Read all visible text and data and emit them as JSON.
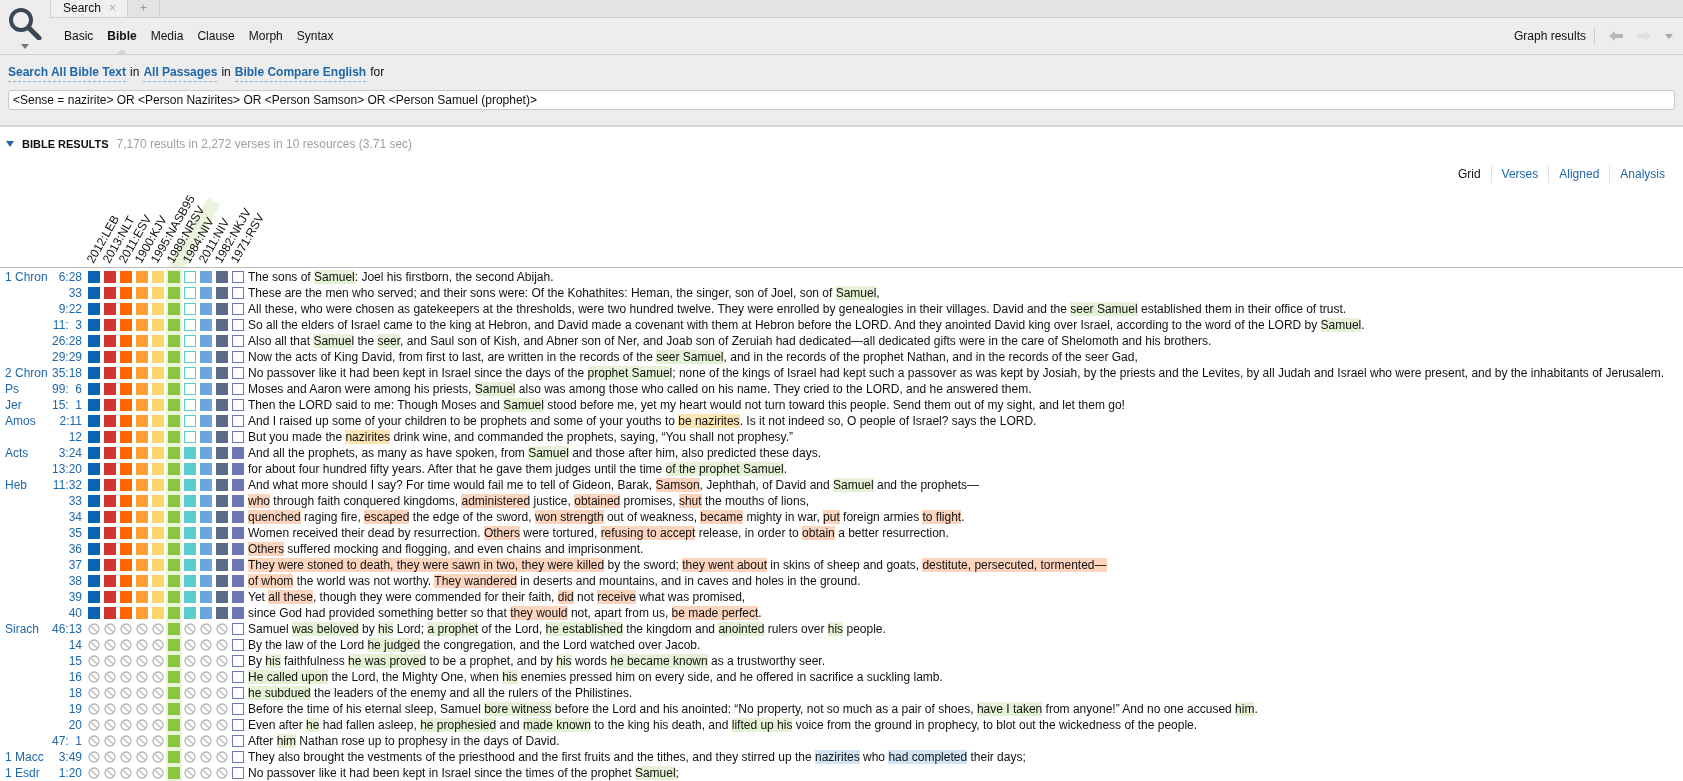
{
  "tabs": [
    {
      "label": "Search",
      "selected": true,
      "close": "×"
    },
    {
      "label": "+",
      "selected": false
    }
  ],
  "search_types": [
    {
      "label": "Basic",
      "selected": false
    },
    {
      "label": "Bible",
      "selected": true
    },
    {
      "label": "Media",
      "selected": false
    },
    {
      "label": "Clause",
      "selected": false
    },
    {
      "label": "Morph",
      "selected": false
    },
    {
      "label": "Syntax",
      "selected": false
    }
  ],
  "toolbar_right": {
    "graph": "Graph results"
  },
  "query_line": [
    {
      "text": "Search All Bible Text",
      "kind": "link"
    },
    {
      "text": "in",
      "kind": "plain"
    },
    {
      "text": "All Passages",
      "kind": "link"
    },
    {
      "text": "in",
      "kind": "plain"
    },
    {
      "text": "Bible Compare English",
      "kind": "link"
    },
    {
      "text": "for",
      "kind": "plain"
    }
  ],
  "query": {
    "value": "<Sense = nazirite> OR <Person Nazirites> OR <Person Samson> OR <Person Samuel (prophet)>"
  },
  "results": {
    "title": "BIBLE RESULTS",
    "expanded": true,
    "summary": "7,170 results in 2,272 verses in 10 resources (3.71 sec)"
  },
  "views": [
    {
      "label": "Grid",
      "selected": true
    },
    {
      "label": "Verses",
      "selected": false
    },
    {
      "label": "Aligned",
      "selected": false
    },
    {
      "label": "Analysis",
      "selected": false
    }
  ],
  "columns": [
    {
      "label": "2012:LEB",
      "color": "#0a64b4",
      "selected": false
    },
    {
      "label": "2013:NLT",
      "color": "#d0352f",
      "selected": false
    },
    {
      "label": "2011:ESV",
      "color": "#ff6600",
      "selected": false
    },
    {
      "label": "1900:KJV",
      "color": "#ff9e33",
      "selected": false
    },
    {
      "label": "1995:NASB95",
      "color": "#ffd56a",
      "selected": false
    },
    {
      "label": "1989:NRSV",
      "color": "#8cc63f",
      "selected": true
    },
    {
      "label": "1984:NIV",
      "color": "#5ccccc",
      "selected": false
    },
    {
      "label": "2011:NIV",
      "color": "#6aa5e0",
      "selected": false
    },
    {
      "label": "1982:NKJV",
      "color": "#5c6b86",
      "selected": false
    },
    {
      "label": "1971:RSV",
      "color": "#6e77b3",
      "selected": false
    }
  ],
  "rows": [
    {
      "book": "1 Chron",
      "ref": "6:28",
      "cells": [
        {
          "kind": "filled"
        },
        {
          "kind": "filled"
        },
        {
          "kind": "filled"
        },
        {
          "kind": "filled"
        },
        {
          "kind": "filled"
        },
        {
          "kind": "filled"
        },
        {
          "kind": "empty"
        },
        {
          "kind": "filled"
        },
        {
          "kind": "filled"
        },
        {
          "kind": "empty"
        }
      ],
      "segments": [
        {
          "text": "The sons of "
        },
        {
          "text": "Samuel",
          "color": "#e6f2d6"
        },
        {
          "text": ": Joel his firstborn, the second Abijah."
        }
      ]
    },
    {
      "ref": "33",
      "cells": [
        {
          "kind": "filled"
        },
        {
          "kind": "filled"
        },
        {
          "kind": "filled"
        },
        {
          "kind": "filled"
        },
        {
          "kind": "filled"
        },
        {
          "kind": "filled"
        },
        {
          "kind": "empty"
        },
        {
          "kind": "filled"
        },
        {
          "kind": "filled"
        },
        {
          "kind": "empty"
        }
      ],
      "segments": [
        {
          "text": "These are the men who served; and their sons were: Of the Kohathites: Heman, the singer, son of Joel, son of "
        },
        {
          "text": "Samuel",
          "color": "#e6f2d6"
        },
        {
          "text": ","
        }
      ]
    },
    {
      "ref": "9:22",
      "cells": [
        {
          "kind": "filled"
        },
        {
          "kind": "filled"
        },
        {
          "kind": "filled"
        },
        {
          "kind": "filled"
        },
        {
          "kind": "filled"
        },
        {
          "kind": "filled"
        },
        {
          "kind": "empty"
        },
        {
          "kind": "filled"
        },
        {
          "kind": "filled"
        },
        {
          "kind": "empty"
        }
      ],
      "segments": [
        {
          "text": "All these, who were chosen as gatekeepers at the thresholds, were two hundred twelve. They were enrolled by genealogies in their villages. David and the "
        },
        {
          "text": "seer Samuel",
          "color": "#e6f2d6"
        },
        {
          "text": " established them in their office of trust."
        }
      ]
    },
    {
      "ref": "11:  3",
      "cells": [
        {
          "kind": "filled"
        },
        {
          "kind": "filled"
        },
        {
          "kind": "filled"
        },
        {
          "kind": "filled"
        },
        {
          "kind": "filled"
        },
        {
          "kind": "filled"
        },
        {
          "kind": "empty"
        },
        {
          "kind": "filled"
        },
        {
          "kind": "filled"
        },
        {
          "kind": "empty"
        }
      ],
      "segments": [
        {
          "text": "So all the elders of Israel came to the king at Hebron, and David made a covenant with them at Hebron before the LORD. And they anointed David king over Israel, according to the word of the LORD by "
        },
        {
          "text": "Samuel",
          "color": "#e6f2d6"
        },
        {
          "text": "."
        }
      ]
    },
    {
      "ref": "26:28",
      "cells": [
        {
          "kind": "filled"
        },
        {
          "kind": "filled"
        },
        {
          "kind": "filled"
        },
        {
          "kind": "filled"
        },
        {
          "kind": "filled"
        },
        {
          "kind": "filled"
        },
        {
          "kind": "empty"
        },
        {
          "kind": "filled"
        },
        {
          "kind": "filled"
        },
        {
          "kind": "empty"
        }
      ],
      "segments": [
        {
          "text": "Also all that "
        },
        {
          "text": "Samuel",
          "color": "#e6f2d6"
        },
        {
          "text": " the "
        },
        {
          "text": "seer",
          "color": "#e6f2d6"
        },
        {
          "text": ", and Saul son of Kish, and Abner son of Ner, and Joab son of Zeruiah had dedicated—all dedicated gifts were in the care of Shelomoth and his brothers."
        }
      ]
    },
    {
      "ref": "29:29",
      "cells": [
        {
          "kind": "filled"
        },
        {
          "kind": "filled"
        },
        {
          "kind": "filled"
        },
        {
          "kind": "filled"
        },
        {
          "kind": "filled"
        },
        {
          "kind": "filled"
        },
        {
          "kind": "empty"
        },
        {
          "kind": "filled"
        },
        {
          "kind": "filled"
        },
        {
          "kind": "empty"
        }
      ],
      "segments": [
        {
          "text": "Now the acts of King David, from first to last, are written in the records of the "
        },
        {
          "text": "seer Samuel",
          "color": "#e6f2d6"
        },
        {
          "text": ", and in the records of the prophet Nathan, and in the records of the seer Gad,"
        }
      ]
    },
    {
      "book": "2 Chron",
      "ref": "35:18",
      "cells": [
        {
          "kind": "filled"
        },
        {
          "kind": "filled"
        },
        {
          "kind": "filled"
        },
        {
          "kind": "filled"
        },
        {
          "kind": "filled"
        },
        {
          "kind": "filled"
        },
        {
          "kind": "empty"
        },
        {
          "kind": "filled"
        },
        {
          "kind": "filled"
        },
        {
          "kind": "empty"
        }
      ],
      "segments": [
        {
          "text": "No passover like it had been kept in Israel since the days of the "
        },
        {
          "text": "prophet Samuel",
          "color": "#e6f2d6"
        },
        {
          "text": "; none of the kings of Israel had kept such a passover as was kept by Josiah, by the priests and the Levites, by all Judah and Israel who were present, and by the inhabitants of Jerusalem."
        }
      ]
    },
    {
      "book": "Ps",
      "ref": "99:  6",
      "cells": [
        {
          "kind": "filled"
        },
        {
          "kind": "filled"
        },
        {
          "kind": "filled"
        },
        {
          "kind": "filled"
        },
        {
          "kind": "filled"
        },
        {
          "kind": "filled"
        },
        {
          "kind": "empty"
        },
        {
          "kind": "filled"
        },
        {
          "kind": "filled"
        },
        {
          "kind": "empty"
        }
      ],
      "segments": [
        {
          "text": "Moses and Aaron were among his priests, "
        },
        {
          "text": "Samuel",
          "color": "#e6f2d6"
        },
        {
          "text": " also was among those who called on his name. They cried to the LORD, and he answered them."
        }
      ]
    },
    {
      "book": "Jer",
      "ref": "15:  1",
      "cells": [
        {
          "kind": "filled"
        },
        {
          "kind": "filled"
        },
        {
          "kind": "filled"
        },
        {
          "kind": "filled"
        },
        {
          "kind": "filled"
        },
        {
          "kind": "filled"
        },
        {
          "kind": "empty"
        },
        {
          "kind": "filled"
        },
        {
          "kind": "filled"
        },
        {
          "kind": "empty"
        }
      ],
      "segments": [
        {
          "text": "Then the LORD said to me: Though Moses and "
        },
        {
          "text": "Samuel",
          "color": "#e6f2d6"
        },
        {
          "text": " stood before me, yet my heart would not turn toward this people. Send them out of my sight, and let them go!"
        }
      ]
    },
    {
      "book": "Amos",
      "ref": "2:11",
      "cells": [
        {
          "kind": "filled"
        },
        {
          "kind": "filled"
        },
        {
          "kind": "filled"
        },
        {
          "kind": "filled"
        },
        {
          "kind": "filled"
        },
        {
          "kind": "filled"
        },
        {
          "kind": "empty"
        },
        {
          "kind": "filled"
        },
        {
          "kind": "filled"
        },
        {
          "kind": "empty"
        }
      ],
      "segments": [
        {
          "text": "And I raised up some of your children to be prophets and some of your youths to "
        },
        {
          "text": "be nazirites",
          "color": "#fde6b3"
        },
        {
          "text": ". Is it not indeed so, O people of Israel? says the LORD."
        }
      ]
    },
    {
      "ref": "12",
      "cells": [
        {
          "kind": "filled"
        },
        {
          "kind": "filled"
        },
        {
          "kind": "filled"
        },
        {
          "kind": "filled"
        },
        {
          "kind": "filled"
        },
        {
          "kind": "filled"
        },
        {
          "kind": "empty"
        },
        {
          "kind": "filled"
        },
        {
          "kind": "filled"
        },
        {
          "kind": "empty"
        }
      ],
      "segments": [
        {
          "text": "But you made the "
        },
        {
          "text": "nazirites",
          "color": "#fde6b3"
        },
        {
          "text": " drink wine, and commanded the prophets, saying, “You shall not prophesy.”"
        }
      ]
    },
    {
      "book": "Acts",
      "ref": "3:24",
      "cells": [
        {
          "kind": "filled"
        },
        {
          "kind": "filled"
        },
        {
          "kind": "filled"
        },
        {
          "kind": "filled"
        },
        {
          "kind": "filled"
        },
        {
          "kind": "filled"
        },
        {
          "kind": "filled"
        },
        {
          "kind": "filled"
        },
        {
          "kind": "filled"
        },
        {
          "kind": "filled"
        }
      ],
      "segments": [
        {
          "text": "And all the prophets, as many as have spoken, from "
        },
        {
          "text": "Samuel",
          "color": "#e6f2d6"
        },
        {
          "text": " and those after him, also predicted these days."
        }
      ]
    },
    {
      "ref": "13:20",
      "cells": [
        {
          "kind": "filled"
        },
        {
          "kind": "filled"
        },
        {
          "kind": "filled"
        },
        {
          "kind": "filled"
        },
        {
          "kind": "filled"
        },
        {
          "kind": "filled"
        },
        {
          "kind": "filled"
        },
        {
          "kind": "filled"
        },
        {
          "kind": "filled"
        },
        {
          "kind": "filled"
        }
      ],
      "segments": [
        {
          "text": "for about four hundred fifty years. After that he gave them judges until the time "
        },
        {
          "text": "of the prophet Samuel",
          "color": "#e6f2d6"
        },
        {
          "text": "."
        }
      ]
    },
    {
      "book": "Heb",
      "ref": "11:32",
      "cells": [
        {
          "kind": "filled"
        },
        {
          "kind": "filled"
        },
        {
          "kind": "filled"
        },
        {
          "kind": "filled"
        },
        {
          "kind": "filled"
        },
        {
          "kind": "filled"
        },
        {
          "kind": "filled"
        },
        {
          "kind": "filled"
        },
        {
          "kind": "filled"
        },
        {
          "kind": "filled"
        }
      ],
      "segments": [
        {
          "text": "And what more should I say? For time would fail me to tell of Gideon, Barak, "
        },
        {
          "text": "Samson",
          "color": "#fdd5bf"
        },
        {
          "text": ", Jephthah, of David and "
        },
        {
          "text": "Samuel",
          "color": "#e6f2d6"
        },
        {
          "text": " and the prophets—"
        }
      ]
    },
    {
      "ref": "33",
      "cells": [
        {
          "kind": "filled"
        },
        {
          "kind": "filled"
        },
        {
          "kind": "filled"
        },
        {
          "kind": "filled"
        },
        {
          "kind": "filled"
        },
        {
          "kind": "filled"
        },
        {
          "kind": "filled"
        },
        {
          "kind": "filled"
        },
        {
          "kind": "filled"
        },
        {
          "kind": "filled"
        }
      ],
      "segments": [
        {
          "text": "who",
          "color": "#fdd5bf"
        },
        {
          "text": " through faith conquered kingdoms, "
        },
        {
          "text": "administered",
          "color": "#fdd5bf"
        },
        {
          "text": " justice, "
        },
        {
          "text": "obtained",
          "color": "#fdd5bf"
        },
        {
          "text": " promises, "
        },
        {
          "text": "shut",
          "color": "#fdd5bf"
        },
        {
          "text": " the mouths of lions,"
        }
      ]
    },
    {
      "ref": "34",
      "cells": [
        {
          "kind": "filled"
        },
        {
          "kind": "filled"
        },
        {
          "kind": "filled"
        },
        {
          "kind": "filled"
        },
        {
          "kind": "filled"
        },
        {
          "kind": "filled"
        },
        {
          "kind": "filled"
        },
        {
          "kind": "filled"
        },
        {
          "kind": "filled"
        },
        {
          "kind": "filled"
        }
      ],
      "segments": [
        {
          "text": "quenched",
          "color": "#fdd5bf"
        },
        {
          "text": " raging fire, "
        },
        {
          "text": "escaped",
          "color": "#fdd5bf"
        },
        {
          "text": " the edge of the sword, "
        },
        {
          "text": "won strength",
          "color": "#fdd5bf"
        },
        {
          "text": " out of weakness, "
        },
        {
          "text": "became",
          "color": "#fdd5bf"
        },
        {
          "text": " mighty in war, "
        },
        {
          "text": "put",
          "color": "#fdd5bf"
        },
        {
          "text": " foreign armies "
        },
        {
          "text": "to flight",
          "color": "#fdd5bf"
        },
        {
          "text": "."
        }
      ]
    },
    {
      "ref": "35",
      "cells": [
        {
          "kind": "filled"
        },
        {
          "kind": "filled"
        },
        {
          "kind": "filled"
        },
        {
          "kind": "filled"
        },
        {
          "kind": "filled"
        },
        {
          "kind": "filled"
        },
        {
          "kind": "filled"
        },
        {
          "kind": "filled"
        },
        {
          "kind": "filled"
        },
        {
          "kind": "filled"
        }
      ],
      "segments": [
        {
          "text": "Women received their dead by resurrection. "
        },
        {
          "text": "Others",
          "color": "#fdd5bf"
        },
        {
          "text": " were tortured, "
        },
        {
          "text": "refusing to accept",
          "color": "#fdd5bf"
        },
        {
          "text": " release, in order to "
        },
        {
          "text": "obtain",
          "color": "#fdd5bf"
        },
        {
          "text": " a better resurrection."
        }
      ]
    },
    {
      "ref": "36",
      "cells": [
        {
          "kind": "filled"
        },
        {
          "kind": "filled"
        },
        {
          "kind": "filled"
        },
        {
          "kind": "filled"
        },
        {
          "kind": "filled"
        },
        {
          "kind": "filled"
        },
        {
          "kind": "filled"
        },
        {
          "kind": "filled"
        },
        {
          "kind": "filled"
        },
        {
          "kind": "filled"
        }
      ],
      "segments": [
        {
          "text": "Others",
          "color": "#fdd5bf"
        },
        {
          "text": " suffered mocking and flogging, and even chains and imprisonment."
        }
      ]
    },
    {
      "ref": "37",
      "cells": [
        {
          "kind": "filled"
        },
        {
          "kind": "filled"
        },
        {
          "kind": "filled"
        },
        {
          "kind": "filled"
        },
        {
          "kind": "filled"
        },
        {
          "kind": "filled"
        },
        {
          "kind": "filled"
        },
        {
          "kind": "filled"
        },
        {
          "kind": "filled"
        },
        {
          "kind": "filled"
        }
      ],
      "segments": [
        {
          "text": "They were stoned to death, they were sawn in two, they were killed",
          "color": "#fdd5bf"
        },
        {
          "text": " by the sword; "
        },
        {
          "text": "they went about",
          "color": "#fdd5bf"
        },
        {
          "text": " in skins of sheep and goats, "
        },
        {
          "text": "destitute, persecuted, tormented—",
          "color": "#fdd5bf"
        }
      ]
    },
    {
      "ref": "38",
      "cells": [
        {
          "kind": "filled"
        },
        {
          "kind": "filled"
        },
        {
          "kind": "filled"
        },
        {
          "kind": "filled"
        },
        {
          "kind": "filled"
        },
        {
          "kind": "filled"
        },
        {
          "kind": "filled"
        },
        {
          "kind": "filled"
        },
        {
          "kind": "filled"
        },
        {
          "kind": "filled"
        }
      ],
      "segments": [
        {
          "text": "of whom",
          "color": "#fdd5bf"
        },
        {
          "text": " the world was not worthy. "
        },
        {
          "text": "They wandered",
          "color": "#fdd5bf"
        },
        {
          "text": " in deserts and mountains, and in caves and holes in the ground."
        }
      ]
    },
    {
      "ref": "39",
      "cells": [
        {
          "kind": "filled"
        },
        {
          "kind": "filled"
        },
        {
          "kind": "filled"
        },
        {
          "kind": "filled"
        },
        {
          "kind": "filled"
        },
        {
          "kind": "filled"
        },
        {
          "kind": "filled"
        },
        {
          "kind": "filled"
        },
        {
          "kind": "filled"
        },
        {
          "kind": "filled"
        }
      ],
      "segments": [
        {
          "text": "Yet "
        },
        {
          "text": "all these",
          "color": "#fdd5bf"
        },
        {
          "text": ", though they were commended for their faith, "
        },
        {
          "text": "did",
          "color": "#fdd5bf"
        },
        {
          "text": " not "
        },
        {
          "text": "receive",
          "color": "#fdd5bf"
        },
        {
          "text": " what was promised,"
        }
      ]
    },
    {
      "ref": "40",
      "cells": [
        {
          "kind": "filled"
        },
        {
          "kind": "filled"
        },
        {
          "kind": "filled"
        },
        {
          "kind": "filled"
        },
        {
          "kind": "filled"
        },
        {
          "kind": "filled"
        },
        {
          "kind": "filled"
        },
        {
          "kind": "filled"
        },
        {
          "kind": "filled"
        },
        {
          "kind": "filled"
        }
      ],
      "segments": [
        {
          "text": "since God had provided something better so that "
        },
        {
          "text": "they would",
          "color": "#fdd5bf"
        },
        {
          "text": " not, apart from us, "
        },
        {
          "text": "be made perfect",
          "color": "#fdd5bf"
        },
        {
          "text": "."
        }
      ]
    },
    {
      "book": "Sirach",
      "ref": "46:13",
      "cells": [
        {
          "kind": "none"
        },
        {
          "kind": "none"
        },
        {
          "kind": "none"
        },
        {
          "kind": "none"
        },
        {
          "kind": "none"
        },
        {
          "kind": "filled"
        },
        {
          "kind": "none"
        },
        {
          "kind": "none"
        },
        {
          "kind": "none"
        },
        {
          "kind": "empty"
        }
      ],
      "segments": [
        {
          "text": "Samuel "
        },
        {
          "text": "was beloved",
          "color": "#e6f2d6"
        },
        {
          "text": " by "
        },
        {
          "text": "his",
          "color": "#e6f2d6"
        },
        {
          "text": " Lord; "
        },
        {
          "text": "a prophet",
          "color": "#e6f2d6"
        },
        {
          "text": " of the Lord, "
        },
        {
          "text": "he established",
          "color": "#e6f2d6"
        },
        {
          "text": " the kingdom and "
        },
        {
          "text": "anointed",
          "color": "#e6f2d6"
        },
        {
          "text": " rulers over "
        },
        {
          "text": "his",
          "color": "#e6f2d6"
        },
        {
          "text": " people."
        }
      ]
    },
    {
      "ref": "14",
      "cells": [
        {
          "kind": "none"
        },
        {
          "kind": "none"
        },
        {
          "kind": "none"
        },
        {
          "kind": "none"
        },
        {
          "kind": "none"
        },
        {
          "kind": "filled"
        },
        {
          "kind": "none"
        },
        {
          "kind": "none"
        },
        {
          "kind": "none"
        },
        {
          "kind": "empty"
        }
      ],
      "segments": [
        {
          "text": "By the law of the Lord "
        },
        {
          "text": "he judged",
          "color": "#e6f2d6"
        },
        {
          "text": " the congregation, and the Lord watched over Jacob."
        }
      ]
    },
    {
      "ref": "15",
      "cells": [
        {
          "kind": "none"
        },
        {
          "kind": "none"
        },
        {
          "kind": "none"
        },
        {
          "kind": "none"
        },
        {
          "kind": "none"
        },
        {
          "kind": "filled"
        },
        {
          "kind": "none"
        },
        {
          "kind": "none"
        },
        {
          "kind": "none"
        },
        {
          "kind": "empty"
        }
      ],
      "segments": [
        {
          "text": "By "
        },
        {
          "text": "his",
          "color": "#e6f2d6"
        },
        {
          "text": " faithfulness "
        },
        {
          "text": "he was proved",
          "color": "#e6f2d6"
        },
        {
          "text": " to be a prophet, and by "
        },
        {
          "text": "his",
          "color": "#e6f2d6"
        },
        {
          "text": " words "
        },
        {
          "text": "he became known",
          "color": "#e6f2d6"
        },
        {
          "text": " as a trustworthy seer."
        }
      ]
    },
    {
      "ref": "16",
      "cells": [
        {
          "kind": "none"
        },
        {
          "kind": "none"
        },
        {
          "kind": "none"
        },
        {
          "kind": "none"
        },
        {
          "kind": "none"
        },
        {
          "kind": "filled"
        },
        {
          "kind": "none"
        },
        {
          "kind": "none"
        },
        {
          "kind": "none"
        },
        {
          "kind": "empty"
        }
      ],
      "segments": [
        {
          "text": "He called upon",
          "color": "#e6f2d6"
        },
        {
          "text": " the Lord, the Mighty One, when "
        },
        {
          "text": "his",
          "color": "#e6f2d6"
        },
        {
          "text": " enemies pressed him on every side, and he offered in sacrifice a suckling lamb."
        }
      ]
    },
    {
      "ref": "18",
      "cells": [
        {
          "kind": "none"
        },
        {
          "kind": "none"
        },
        {
          "kind": "none"
        },
        {
          "kind": "none"
        },
        {
          "kind": "none"
        },
        {
          "kind": "filled"
        },
        {
          "kind": "none"
        },
        {
          "kind": "none"
        },
        {
          "kind": "none"
        },
        {
          "kind": "empty"
        }
      ],
      "segments": [
        {
          "text": "he subdued",
          "color": "#e6f2d6"
        },
        {
          "text": " the leaders of the enemy and all the rulers of the Philistines."
        }
      ]
    },
    {
      "ref": "19",
      "cells": [
        {
          "kind": "none"
        },
        {
          "kind": "none"
        },
        {
          "kind": "none"
        },
        {
          "kind": "none"
        },
        {
          "kind": "none"
        },
        {
          "kind": "filled"
        },
        {
          "kind": "none"
        },
        {
          "kind": "none"
        },
        {
          "kind": "none"
        },
        {
          "kind": "empty"
        }
      ],
      "segments": [
        {
          "text": "Before the time of his eternal sleep, Samuel "
        },
        {
          "text": "bore witness",
          "color": "#e6f2d6"
        },
        {
          "text": " before the Lord and his anointed: “No property, not so much as a pair of shoes, "
        },
        {
          "text": "have I taken",
          "color": "#e6f2d6"
        },
        {
          "text": " from anyone!” And no one accused "
        },
        {
          "text": "him",
          "color": "#e6f2d6"
        },
        {
          "text": "."
        }
      ]
    },
    {
      "ref": "20",
      "cells": [
        {
          "kind": "none"
        },
        {
          "kind": "none"
        },
        {
          "kind": "none"
        },
        {
          "kind": "none"
        },
        {
          "kind": "none"
        },
        {
          "kind": "filled"
        },
        {
          "kind": "none"
        },
        {
          "kind": "none"
        },
        {
          "kind": "none"
        },
        {
          "kind": "empty"
        }
      ],
      "segments": [
        {
          "text": "Even after "
        },
        {
          "text": "he",
          "color": "#e6f2d6"
        },
        {
          "text": " had fallen asleep, "
        },
        {
          "text": "he prophesied",
          "color": "#e6f2d6"
        },
        {
          "text": " and "
        },
        {
          "text": "made known",
          "color": "#e6f2d6"
        },
        {
          "text": " to the king his death, and "
        },
        {
          "text": "lifted up his",
          "color": "#e6f2d6"
        },
        {
          "text": " voice from the ground in prophecy, to blot out the wickedness of the people."
        }
      ]
    },
    {
      "ref": "47:  1",
      "cells": [
        {
          "kind": "none"
        },
        {
          "kind": "none"
        },
        {
          "kind": "none"
        },
        {
          "kind": "none"
        },
        {
          "kind": "none"
        },
        {
          "kind": "filled"
        },
        {
          "kind": "none"
        },
        {
          "kind": "none"
        },
        {
          "kind": "none"
        },
        {
          "kind": "empty"
        }
      ],
      "segments": [
        {
          "text": "After "
        },
        {
          "text": "him",
          "color": "#e6f2d6"
        },
        {
          "text": " Nathan rose up to prophesy in the days of David."
        }
      ]
    },
    {
      "book": "1 Macc",
      "ref": "3:49",
      "cells": [
        {
          "kind": "none"
        },
        {
          "kind": "none"
        },
        {
          "kind": "none"
        },
        {
          "kind": "none"
        },
        {
          "kind": "none"
        },
        {
          "kind": "filled"
        },
        {
          "kind": "none"
        },
        {
          "kind": "none"
        },
        {
          "kind": "none"
        },
        {
          "kind": "empty"
        }
      ],
      "segments": [
        {
          "text": "They also brought the vestments of the priesthood and the first fruits and the tithes, and they stirred up the "
        },
        {
          "text": "nazirites",
          "color": "#d3e5f5"
        },
        {
          "text": " who "
        },
        {
          "text": "had completed",
          "color": "#d3e5f5"
        },
        {
          "text": " their days;"
        }
      ]
    },
    {
      "book": "1 Esdr",
      "ref": "1:20",
      "cells": [
        {
          "kind": "none"
        },
        {
          "kind": "none"
        },
        {
          "kind": "none"
        },
        {
          "kind": "none"
        },
        {
          "kind": "none"
        },
        {
          "kind": "filled"
        },
        {
          "kind": "none"
        },
        {
          "kind": "none"
        },
        {
          "kind": "none"
        },
        {
          "kind": "empty"
        }
      ],
      "segments": [
        {
          "text": "No passover like it had been kept in Israel since the times of the prophet "
        },
        {
          "text": "Samuel",
          "color": "#e6f2d6"
        },
        {
          "text": ";"
        }
      ]
    }
  ]
}
